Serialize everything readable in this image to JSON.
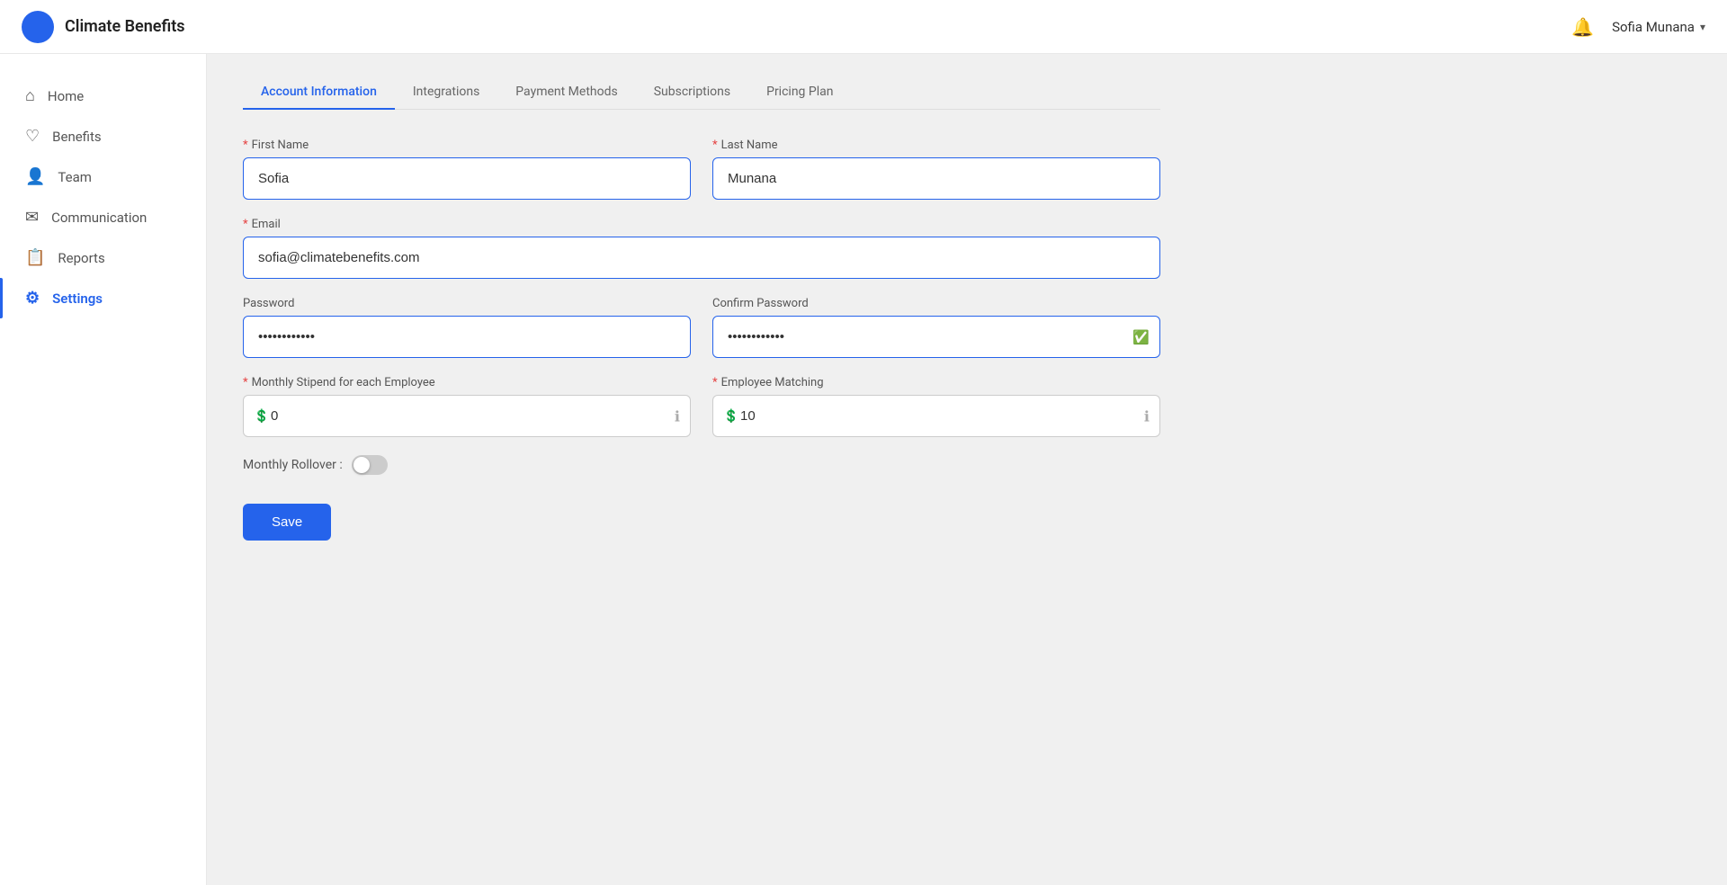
{
  "app": {
    "name": "Climate Benefits"
  },
  "topnav": {
    "user_label": "Sofia Munana",
    "chevron": "▾"
  },
  "sidebar": {
    "items": [
      {
        "id": "home",
        "label": "Home",
        "icon": "⌂"
      },
      {
        "id": "benefits",
        "label": "Benefits",
        "icon": "♡"
      },
      {
        "id": "team",
        "label": "Team",
        "icon": "👤"
      },
      {
        "id": "communication",
        "label": "Communication",
        "icon": "✉"
      },
      {
        "id": "reports",
        "label": "Reports",
        "icon": "📋"
      },
      {
        "id": "settings",
        "label": "Settings",
        "icon": "⚙",
        "active": true
      }
    ]
  },
  "tabs": [
    {
      "id": "account",
      "label": "Account Information",
      "active": true
    },
    {
      "id": "integrations",
      "label": "Integrations",
      "active": false
    },
    {
      "id": "payment",
      "label": "Payment Methods",
      "active": false
    },
    {
      "id": "subscriptions",
      "label": "Subscriptions",
      "active": false
    },
    {
      "id": "pricing",
      "label": "Pricing Plan",
      "active": false
    }
  ],
  "form": {
    "first_name_label": "First Name",
    "first_name_value": "Sofia",
    "last_name_label": "Last Name",
    "last_name_value": "Munana",
    "email_label": "Email",
    "email_value": "sofia@climatebenefits.com",
    "password_label": "Password",
    "password_value": "············",
    "confirm_password_label": "Confirm Password",
    "confirm_password_value": "············",
    "stipend_label": "Monthly Stipend for each Employee",
    "stipend_value": "0",
    "employee_matching_label": "Employee Matching",
    "employee_matching_value": "10",
    "monthly_rollover_label": "Monthly Rollover :",
    "save_label": "Save",
    "required_mark": "*"
  }
}
